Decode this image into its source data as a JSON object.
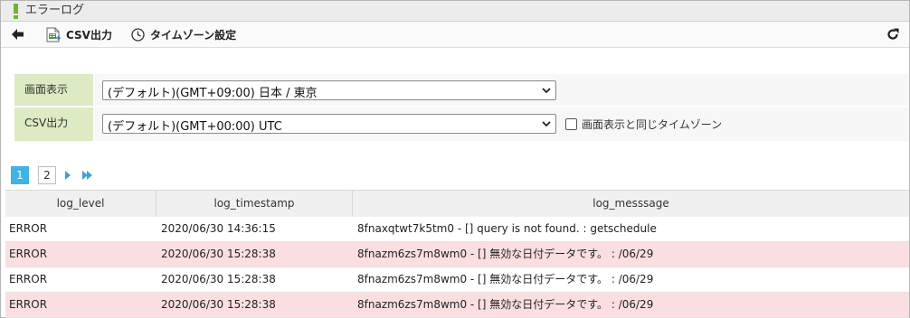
{
  "window": {
    "title": "エラーログ"
  },
  "toolbar": {
    "back_icon": "arrow-left-icon",
    "csv_label": "CSV出力",
    "csv_icon": "csv-export-icon",
    "timezone_label": "タイムゾーン設定",
    "timezone_icon": "clock-icon",
    "refresh_icon": "refresh-icon"
  },
  "settings": {
    "display": {
      "label": "画面表示",
      "value": "(デフォルト)(GMT+09:00) 日本 / 東京"
    },
    "csv": {
      "label": "CSV出力",
      "value": "(デフォルト)(GMT+00:00) UTC",
      "checkbox_label": "画面表示と同じタイムゾーン",
      "checkbox_checked": false
    }
  },
  "pagination": {
    "pages": [
      "1",
      "2"
    ],
    "current": "1"
  },
  "table": {
    "columns": [
      "log_level",
      "log_timestamp",
      "log_messsage"
    ],
    "rows": [
      {
        "level": "ERROR",
        "timestamp": "2020/06/30 14:36:15",
        "message": "8fnaxqtwt7k5tm0 - [] query is not found. : getschedule"
      },
      {
        "level": "ERROR",
        "timestamp": "2020/06/30 15:28:38",
        "message": "8fnazm6zs7m8wm0 - [] 無効な日付データです。 : /06/29"
      },
      {
        "level": "ERROR",
        "timestamp": "2020/06/30 15:28:38",
        "message": "8fnazm6zs7m8wm0 - [] 無効な日付データです。 : /06/29"
      },
      {
        "level": "ERROR",
        "timestamp": "2020/06/30 15:28:38",
        "message": "8fnazm6zs7m8wm0 - [] 無効な日付データです。 : /06/29"
      }
    ]
  },
  "colors": {
    "accent_green": "#6cb52c",
    "label_bg": "#dcebc4",
    "active_page": "#40b3e5",
    "error_row": "#fbdfe0"
  }
}
